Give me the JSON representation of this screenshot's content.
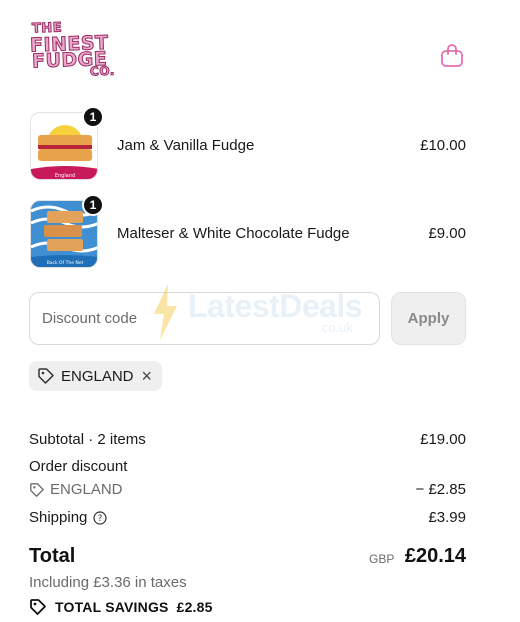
{
  "brand": {
    "logo_lines": [
      "THE",
      "FINEST",
      "FUDGE",
      "CO."
    ]
  },
  "watermark": {
    "brand": "LatestDeals",
    "tld": ".co.uk"
  },
  "cart": {
    "items": [
      {
        "name": "Jam & Vanilla Fudge",
        "price": "£10.00",
        "quantity": "1",
        "thumb_label": "England"
      },
      {
        "name": "Malteser & White Chocolate Fudge",
        "price": "£9.00",
        "quantity": "1",
        "thumb_label": "Back Of The Net"
      }
    ]
  },
  "discount": {
    "placeholder": "Discount code",
    "apply_label": "Apply",
    "applied_code": "ENGLAND"
  },
  "summary": {
    "subtotal_label": "Subtotal · 2 items",
    "subtotal_value": "£19.00",
    "order_discount_label": "Order discount",
    "discount_code": "ENGLAND",
    "discount_value": "− £2.85",
    "shipping_label": "Shipping",
    "shipping_value": "£3.99",
    "total_label": "Total",
    "currency": "GBP",
    "total_value": "£20.14",
    "taxes_note": "Including £3.36 in taxes",
    "savings_label": "TOTAL SAVINGS",
    "savings_value": "£2.85"
  },
  "colors": {
    "brand_pink": "#e9a9cc",
    "brand_outline": "#9b2a63",
    "icon_pink": "#e36fb0"
  }
}
